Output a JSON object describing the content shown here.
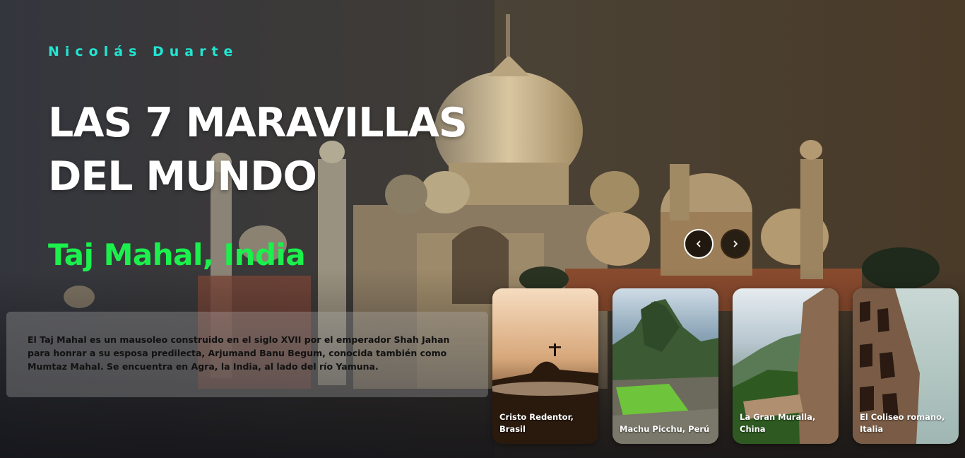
{
  "header": {
    "author": "Nicolás Duarte",
    "title": "LAS 7 MARAVILLAS DEL MUNDO"
  },
  "current": {
    "place": "Taj Mahal, India",
    "description": "El Taj Mahal es un mausoleo construido en el siglo XVII por el emperador Shah Jahan para honrar a su esposa predilecta, Arjumand Banu Begum, conocida también como Mumtaz Mahal. Se encuentra en Agra, la India, al lado del río Yamuna."
  },
  "navigation": {
    "prev_glyph": "‹",
    "next_glyph": "›"
  },
  "cards": [
    {
      "label": "Cristo Redentor, Brasil"
    },
    {
      "label": "Machu Picchu, Perú"
    },
    {
      "label": "La Gran Muralla, China"
    },
    {
      "label": "El Coliseo romano, Italia"
    }
  ],
  "colors": {
    "author": "#22e6d2",
    "place": "#1bf04d",
    "title": "#ffffff"
  }
}
